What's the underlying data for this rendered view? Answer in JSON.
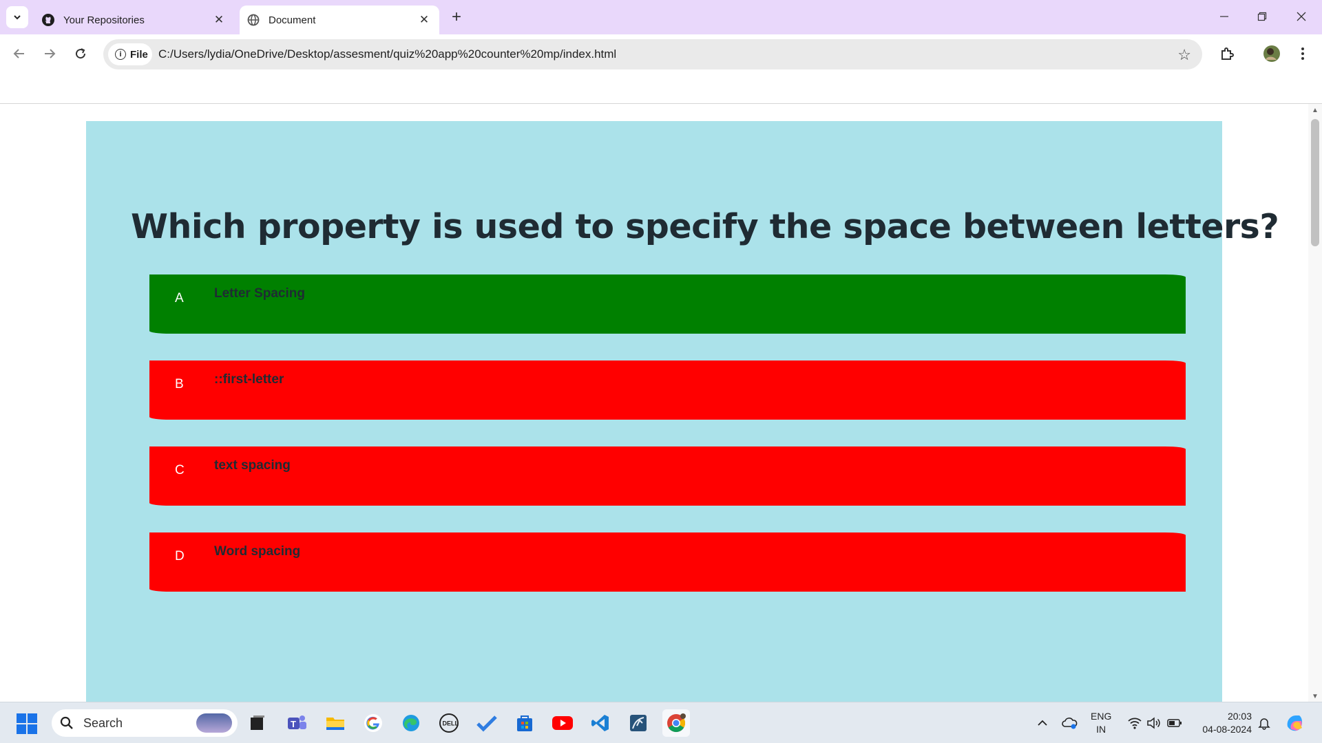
{
  "browser": {
    "tabs": [
      {
        "title": "Your Repositories",
        "icon": "github-icon"
      },
      {
        "title": "Document",
        "icon": "globe-icon"
      }
    ],
    "scheme_chip": "File",
    "url": "C:/Users/lydia/OneDrive/Desktop/assesment/quiz%20app%20counter%20mp/index.html"
  },
  "quiz": {
    "question": "Which property is used to specify the space between letters?",
    "options": [
      {
        "letter": "A",
        "text": "Letter Spacing",
        "state": "correct"
      },
      {
        "letter": "B",
        "text": "::first-letter",
        "state": "wrong"
      },
      {
        "letter": "C",
        "text": "text spacing",
        "state": "wrong"
      },
      {
        "letter": "D",
        "text": "Word spacing",
        "state": "wrong"
      }
    ],
    "colors": {
      "background": "#abe2ea",
      "correct": "#008000",
      "wrong": "#ff0000"
    }
  },
  "taskbar": {
    "search_placeholder": "Search",
    "language": "ENG",
    "region": "IN",
    "time": "20:03",
    "date": "04-08-2024"
  }
}
